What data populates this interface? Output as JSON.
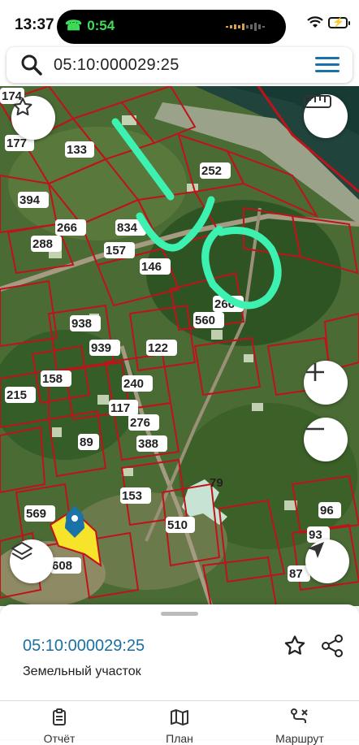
{
  "status": {
    "time": "13:37",
    "call_time": "0:54"
  },
  "search": {
    "query": "05:10:000029:25"
  },
  "map": {
    "parcels": [
      "174",
      "177",
      "133",
      "394",
      "266",
      "288",
      "834",
      "157",
      "146",
      "252",
      "560",
      "266",
      "938",
      "939",
      "122",
      "158",
      "215",
      "240",
      "117",
      "276",
      "388",
      "89",
      "153",
      "510",
      "569",
      "608",
      "96",
      "93",
      "87",
      "79"
    ],
    "drawn_text": "IVO"
  },
  "sheet": {
    "cadastral_number": "05:10:000029:25",
    "property_type": "Земельный участок"
  },
  "tabs": [
    {
      "label": "Отчёт",
      "icon": "report-icon"
    },
    {
      "label": "План",
      "icon": "map-icon"
    },
    {
      "label": "Маршрут",
      "icon": "route-icon"
    }
  ],
  "colors": {
    "accent": "#1a73a8",
    "parcel_border": "#c0121a",
    "drawing": "#3df2b0",
    "selected_parcel": "#f5e42a"
  }
}
